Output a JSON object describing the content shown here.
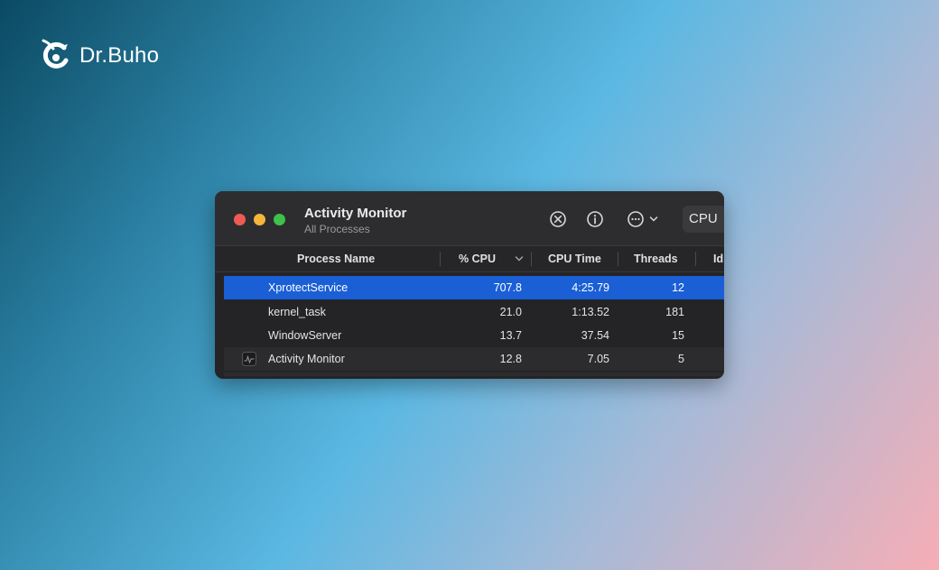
{
  "brand": {
    "name": "Dr.Buho",
    "logo_icon": "owl-logo-icon"
  },
  "window": {
    "title": "Activity Monitor",
    "subtitle": "All Processes",
    "toolbar": {
      "stop_icon": "stop-process-icon",
      "info_icon": "info-icon",
      "more_icon": "more-options-icon",
      "active_tab": "CPU"
    },
    "columns": {
      "process_name": "Process Name",
      "cpu_percent": "% CPU",
      "cpu_time": "CPU Time",
      "threads": "Threads",
      "idle_wakeups": "Id"
    },
    "processes": [
      {
        "name": "XprotectService",
        "cpu": "707.8",
        "cpu_time": "4:25.79",
        "threads": "12"
      },
      {
        "name": "kernel_task",
        "cpu": "21.0",
        "cpu_time": "1:13.52",
        "threads": "181"
      },
      {
        "name": "WindowServer",
        "cpu": "13.7",
        "cpu_time": "37.54",
        "threads": "15"
      },
      {
        "name": "Activity Monitor",
        "cpu": "12.8",
        "cpu_time": "7.05",
        "threads": "5"
      }
    ]
  },
  "colors": {
    "selection": "#1a5fd6",
    "window_bg": "#242426",
    "traffic_red": "#ee5b54",
    "traffic_yellow": "#f3b63a",
    "traffic_green": "#3fc04a"
  }
}
